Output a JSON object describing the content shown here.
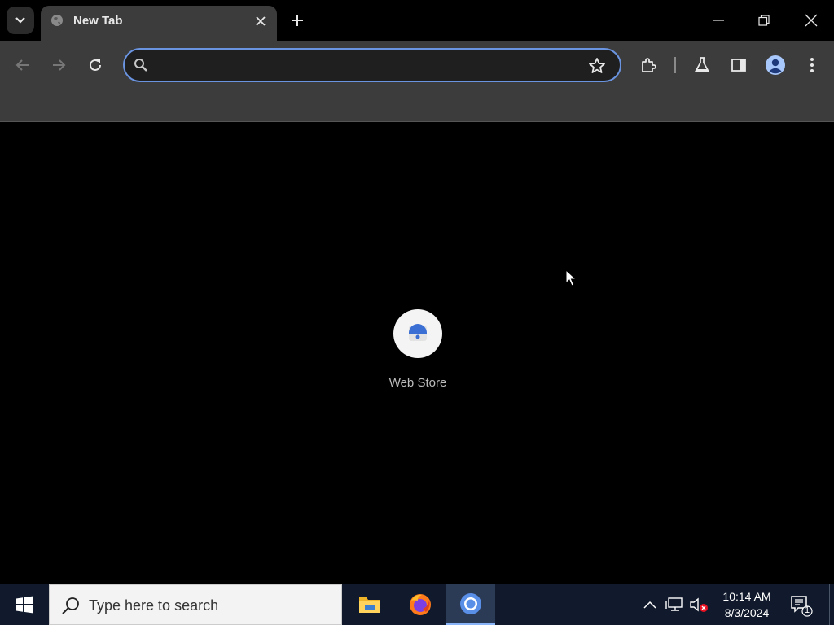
{
  "browser": {
    "tab": {
      "title": "New Tab",
      "favicon": "globe-icon"
    },
    "omnibox": {
      "value": "",
      "placeholder": ""
    },
    "toolbar_icons": [
      "back-icon",
      "forward-icon",
      "reload-icon",
      "extensions-icon",
      "labs-icon",
      "side-panel-icon",
      "profile-icon",
      "menu-icon"
    ]
  },
  "new_tab_page": {
    "shortcuts": [
      {
        "label": "Web Store",
        "icon": "web-store-icon"
      }
    ]
  },
  "taskbar": {
    "search_placeholder": "Type here to search",
    "apps": [
      "file-explorer-icon",
      "firefox-icon",
      "chrome-icon"
    ],
    "active_app": "chrome-icon",
    "clock": {
      "time": "10:14 AM",
      "date": "8/3/2024"
    },
    "notification_count": "1"
  },
  "colors": {
    "accent": "#6a93e0",
    "toolbar_bg": "#3c3c3c",
    "taskbar_bg": "#101a2c"
  }
}
